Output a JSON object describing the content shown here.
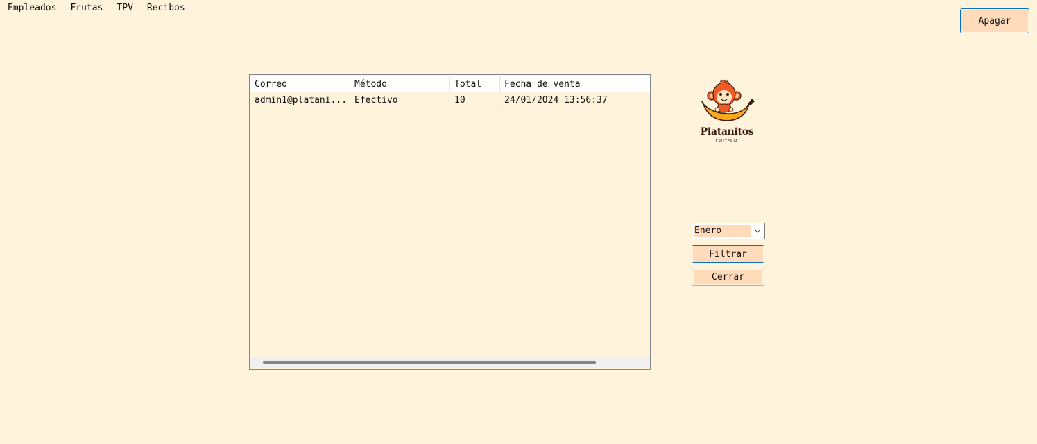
{
  "menu": {
    "items": [
      {
        "label": "Empleados"
      },
      {
        "label": "Frutas"
      },
      {
        "label": "TPV"
      },
      {
        "label": "Recibos"
      }
    ]
  },
  "toolbar": {
    "apagar_label": "Apagar"
  },
  "table": {
    "columns": [
      "Correo",
      "Método",
      "Total",
      "Fecha de venta"
    ],
    "rows": [
      [
        "admin1@platani...",
        "Efectivo",
        "10",
        "24/01/2024 13:56:37"
      ]
    ]
  },
  "logo": {
    "name": "Platanitos",
    "subtitle": "FRUTERIA",
    "icon": "monkey-banana-logo"
  },
  "filter": {
    "month_selected": "Enero",
    "filtrar_label": "Filtrar",
    "cerrar_label": "Cerrar"
  },
  "colors": {
    "background": "#fff3dc",
    "button": "#ffdbbb",
    "focus_border": "#0a6fbd",
    "logo_orange": "#f05a24",
    "logo_banana": "#f7a81b",
    "logo_brown": "#3b1a0e"
  }
}
